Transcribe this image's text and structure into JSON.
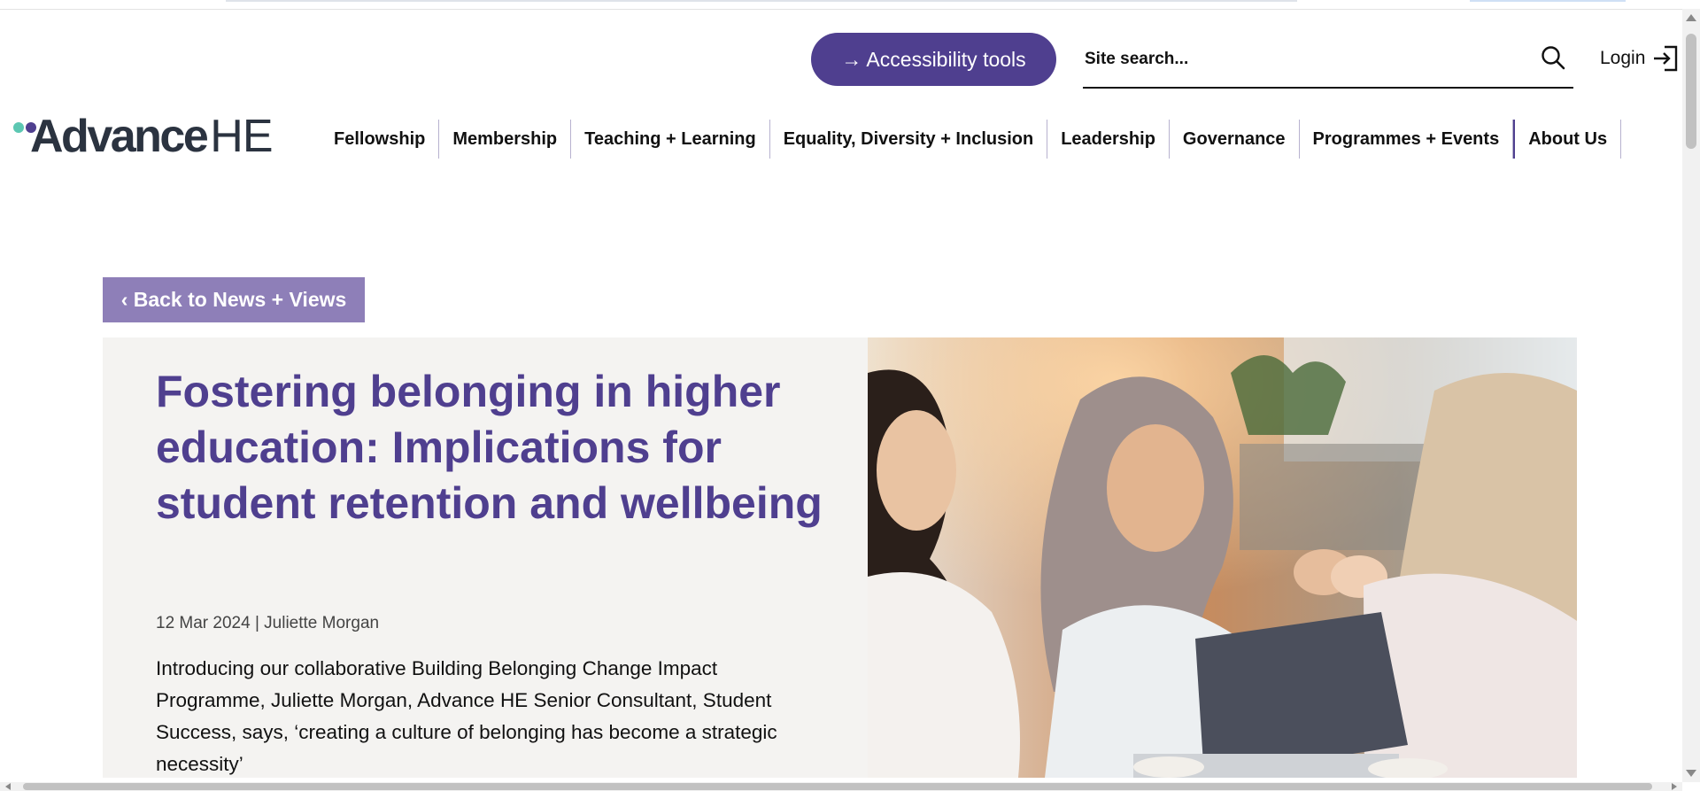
{
  "header": {
    "accessibility_label": "→ Accessibility tools",
    "search_placeholder": "Site search...",
    "search_value": "",
    "login_label": "Login"
  },
  "brand": {
    "name_bold": "Advance",
    "name_light": "HE",
    "dot_colors": [
      "#5cc7b2",
      "#4f3f8f"
    ]
  },
  "nav": {
    "items": [
      {
        "label": "Fellowship"
      },
      {
        "label": "Membership"
      },
      {
        "label": "Teaching + Learning"
      },
      {
        "label": "Equality, Diversity + Inclusion"
      },
      {
        "label": "Leadership"
      },
      {
        "label": "Governance"
      },
      {
        "label": "Programmes + Events"
      },
      {
        "label": "About Us"
      }
    ]
  },
  "article": {
    "back_label": "‹ Back to News + Views",
    "title": "Fostering belonging in higher education: Implications for student retention and wellbeing",
    "meta": "12 Mar 2024 | Juliette Morgan",
    "intro": "Introducing our collaborative Building Belonging Change Impact Programme, Juliette Morgan, Advance HE Senior Consultant, Student Success, says, ‘creating a culture of belonging has become a strategic necessity’"
  },
  "colors": {
    "brand_purple": "#4f3f8f",
    "back_button": "#8e7fb8",
    "hero_panel": "#f4f3f1"
  }
}
